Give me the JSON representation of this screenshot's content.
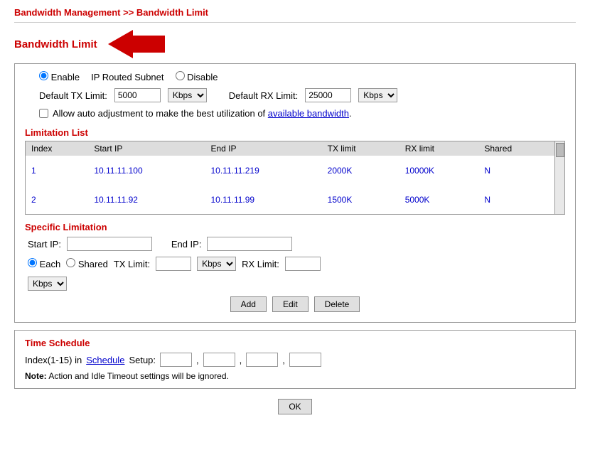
{
  "breadcrumb": {
    "text": "Bandwidth Management >> Bandwidth Limit"
  },
  "section_title": "Bandwidth Limit",
  "main_section": {
    "enable_radio": "Enable",
    "enable_option": "IP Routed Subnet",
    "disable_radio": "Disable",
    "default_tx_label": "Default TX Limit:",
    "default_tx_value": "5000",
    "default_tx_unit": "Kbps",
    "default_rx_label": "Default RX Limit:",
    "default_rx_value": "25000",
    "default_rx_unit": "Kbps",
    "checkbox_label": "Allow auto adjustment to make the best utilization of",
    "checkbox_link": "available bandwidth",
    "checkbox_suffix": ".",
    "limitation_list": {
      "title": "Limitation List",
      "columns": [
        "Index",
        "Start IP",
        "End IP",
        "TX limit",
        "RX limit",
        "Shared"
      ],
      "rows": [
        {
          "index": "1",
          "start_ip": "10.11.11.100",
          "end_ip": "10.11.11.219",
          "tx_limit": "2000K",
          "rx_limit": "10000K",
          "shared": "N"
        },
        {
          "index": "2",
          "start_ip": "10.11.11.92",
          "end_ip": "10.11.11.99",
          "tx_limit": "1500K",
          "rx_limit": "5000K",
          "shared": "N"
        }
      ]
    },
    "specific_limitation": {
      "title": "Specific Limitation",
      "start_ip_label": "Start IP:",
      "end_ip_label": "End IP:",
      "each_label": "Each",
      "shared_label": "Shared",
      "tx_limit_label": "TX Limit:",
      "tx_unit": "Kbps",
      "rx_limit_label": "RX Limit:",
      "rx_unit": "Kbps"
    },
    "buttons": {
      "add": "Add",
      "edit": "Edit",
      "delete": "Delete"
    }
  },
  "time_schedule": {
    "title": "Time Schedule",
    "index_label": "Index(1-15) in",
    "schedule_link": "Schedule",
    "setup_label": "Setup:",
    "fields": [
      "",
      "",
      "",
      ""
    ],
    "note_label": "Note:",
    "note_text": "Action and Idle Timeout settings will be ignored."
  },
  "ok_button": "OK"
}
